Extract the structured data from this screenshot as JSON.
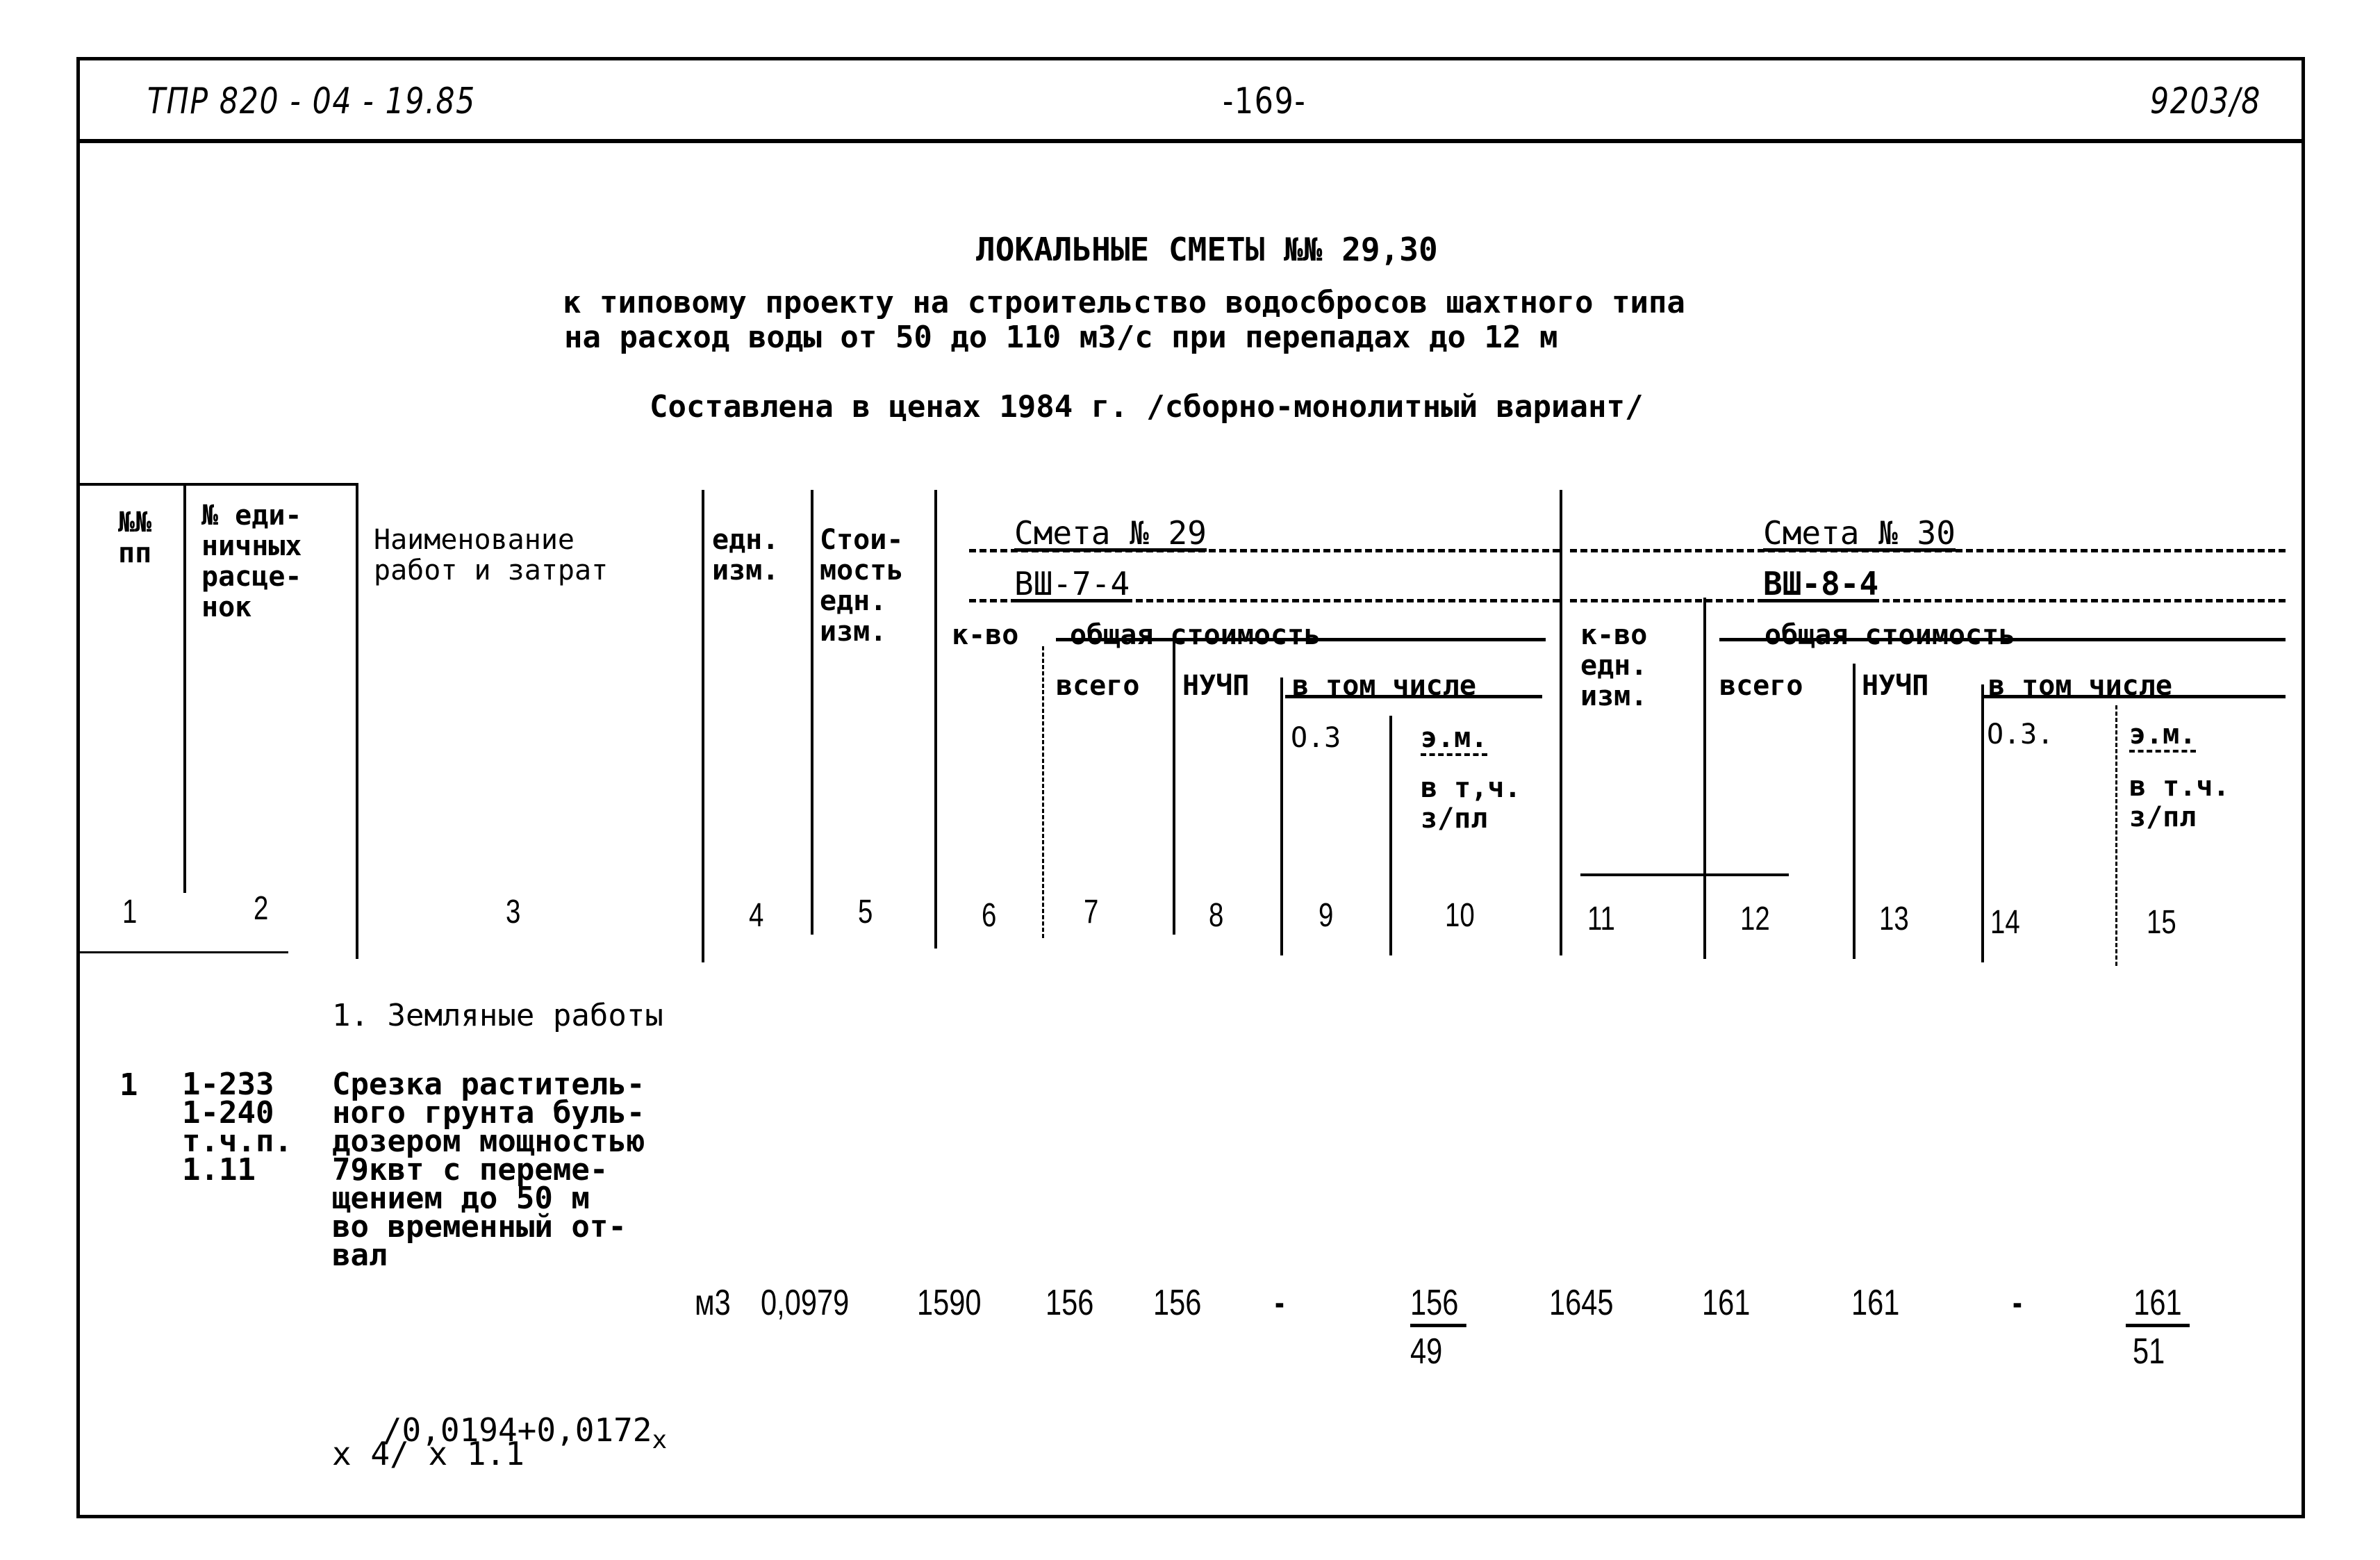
{
  "page_header": {
    "doc_code": "ТПР 820 - 04 - 19.85",
    "page_number": "-169-",
    "sheet_id": "9203/8"
  },
  "title": {
    "main": "ЛОКАЛЬНЫЕ СМЕТЫ №№ 29,30",
    "line1": "к типовому проекту на строительство водосбросов шахтного типа",
    "line2": "на расход воды от 50 до 110 м3/с при перепадах до 12 м",
    "line3": "Составлена в ценах 1984 г. /сборно-монолитный вариант/"
  },
  "table": {
    "headers": {
      "col1": "№№\nпп",
      "col2": "№ еди-\nничных\nрасце-\nнок",
      "col3": "Наименование\nработ и затрат",
      "col4": "едн.\nизм.",
      "col5": "Стои-\nмость\nедн.\nизм.",
      "smeta29_title": "Смета № 29",
      "smeta29_code": "ВШ-7-4",
      "smeta30_title": "Смета № 30",
      "smeta30_code": "ВШ-8-4",
      "qty": "к-во",
      "qty_unit": "к-во\nедн.\nизм.",
      "total_cost": "общая стоимость",
      "total": "всего",
      "nuchp": "НУЧП",
      "including": "в том числе",
      "oz": "О.З",
      "oz30": "О.З.",
      "em": "э.м.",
      "em_sub": "в т,ч.\nз/пл",
      "em_sub30": "в т.ч.\nз/пл"
    },
    "column_numbers": [
      "1",
      "2",
      "3",
      "4",
      "5",
      "6",
      "7",
      "8",
      "9",
      "10",
      "11",
      "12",
      "13",
      "14",
      "15"
    ],
    "section_title": "1. Земляные работы",
    "rows": [
      {
        "no": "1",
        "rate_codes": "1-233\n1-240\nт.ч.п.\n1.11",
        "description": "Срезка раститель-\nного грунта буль-\nдозером мощностью\n79квт с переме-\nщением до 50 м\nво временный от-\nвал",
        "unit": "м3",
        "unit_cost": "0,0979",
        "s29_qty": "1590",
        "s29_total": "156",
        "s29_nuchp": "156",
        "s29_oz": "-",
        "s29_em": "156",
        "s29_em_wage": "49",
        "s30_qty": "1645",
        "s30_total": "161",
        "s30_nuchp": "161",
        "s30_oz": "-",
        "s30_em": "161",
        "s30_em_wage": "51",
        "formula_line1": "/0,0194+0,0172",
        "formula_x": "х",
        "formula_line2": "х 4/ х 1.1"
      }
    ]
  }
}
